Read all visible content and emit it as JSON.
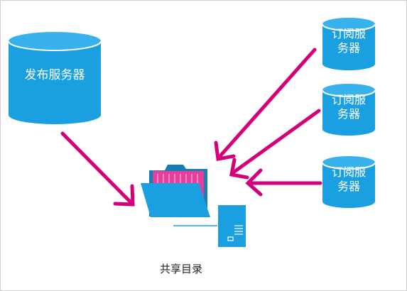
{
  "diagram": {
    "publisher": {
      "label": "发布服务器"
    },
    "subscribers": [
      {
        "line1": "订阅服",
        "line2": "务器"
      },
      {
        "line1": "订阅服",
        "line2": "务器"
      },
      {
        "line1": "订阅服",
        "line2": "务器"
      }
    ],
    "shared_dir": {
      "label": "共享目录"
    },
    "colors": {
      "cylinder": "#1aa0e0",
      "cylinder_top": "#37b2ec",
      "arrow": "#d4007a",
      "folder": "#1aa0e0",
      "folder_back": "#157fb5",
      "paper": "#e83e9a"
    }
  }
}
